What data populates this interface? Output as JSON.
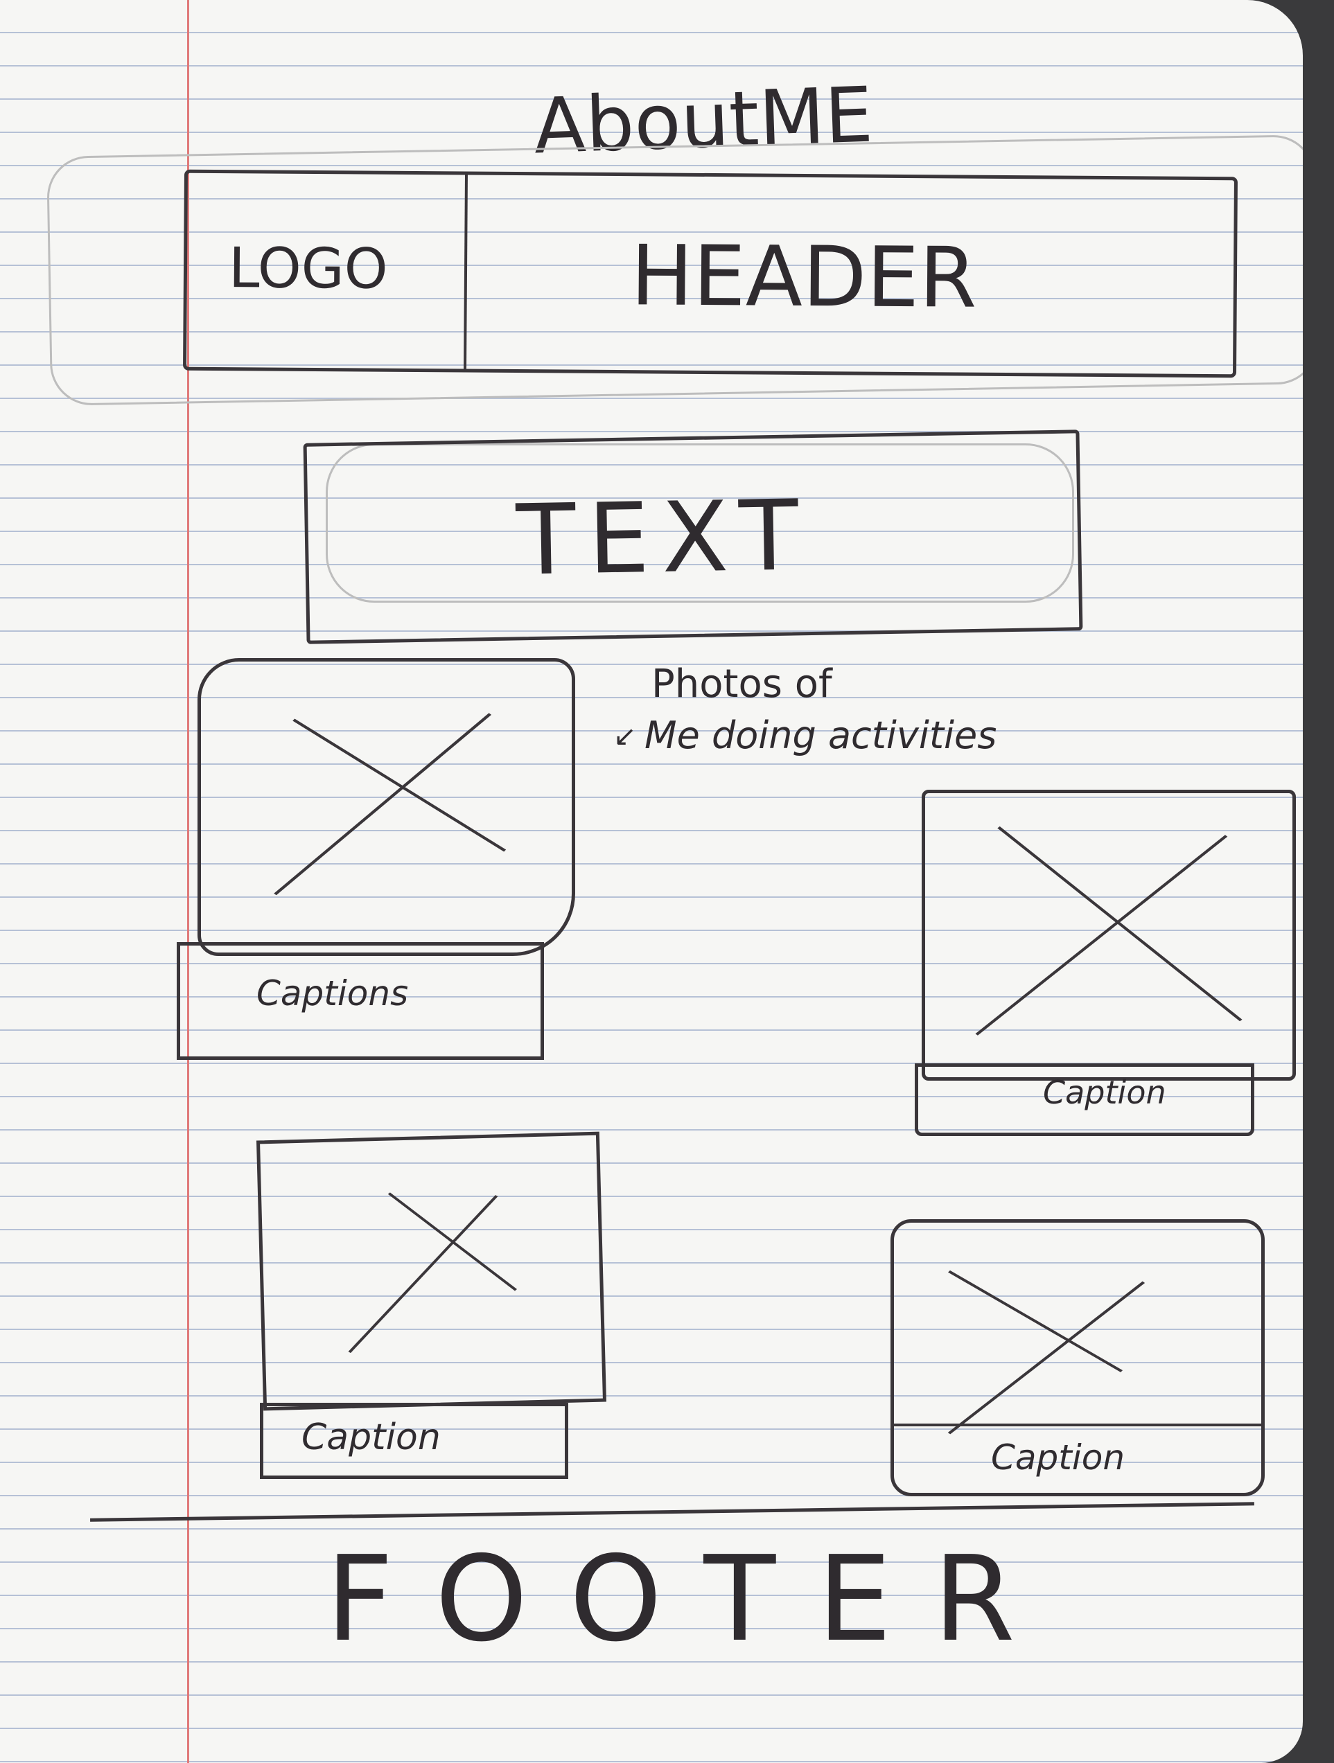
{
  "page": {
    "title": "AboutME",
    "header": {
      "logo": "LOGO",
      "label": "HEADER"
    },
    "text_block": "TEXT",
    "annotation": {
      "line1": "Photos of",
      "line2": "Me doing activities"
    },
    "photos": [
      {
        "caption": "Captions"
      },
      {
        "caption": "Caption"
      },
      {
        "caption": "Caption"
      },
      {
        "caption": "Caption"
      }
    ],
    "footer": "FOOTER"
  },
  "colors": {
    "ink": "#3a363a",
    "paper": "#f6f6f4",
    "rule": "#b6c1d6",
    "margin": "#e07a7a"
  }
}
